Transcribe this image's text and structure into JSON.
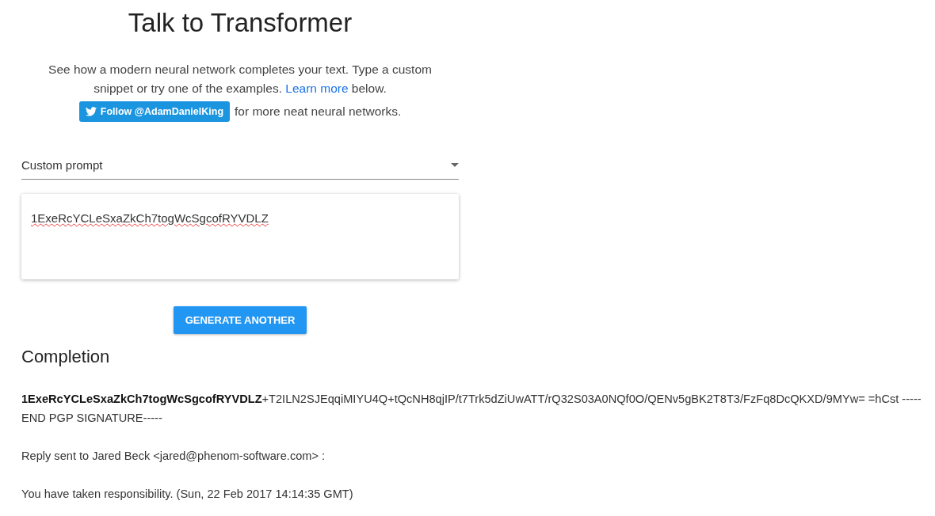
{
  "title": "Talk to Transformer",
  "intro": "See how a modern neural network completes your text. Type a custom snippet or try one of the examples. ",
  "intro_link": "Learn more",
  "intro_tail": " below.",
  "follow_button": "Follow @AdamDanielKing",
  "follow_tail": "for more neat neural networks.",
  "prompt_select": {
    "value": "Custom prompt"
  },
  "prompt_text": "1ExeRcYCLeSxaZkCh7togWcSgcofRYVDLZ",
  "generate_button": "GENERATE ANOTHER",
  "completion": {
    "heading": "Completion",
    "paragraphs": [
      "**1ExeRcYCLeSxaZkCh7togWcSgcofRYVDLZ**+T2ILN2SJEqqiMIYU4Q+tQcNH8qjIP/t7Trk5dZiUwATT/rQ32S03A0NQf0O/QENv5gBK2T8T3/FzFq8DcQKXD/9MYw= =hCst -----END PGP SIGNATURE-----",
      "Reply sent to Jared Beck <jared@phenom-software.com> :",
      "You have taken responsibility. (Sun, 22 Feb 2017 14:14:35 GMT)"
    ]
  }
}
